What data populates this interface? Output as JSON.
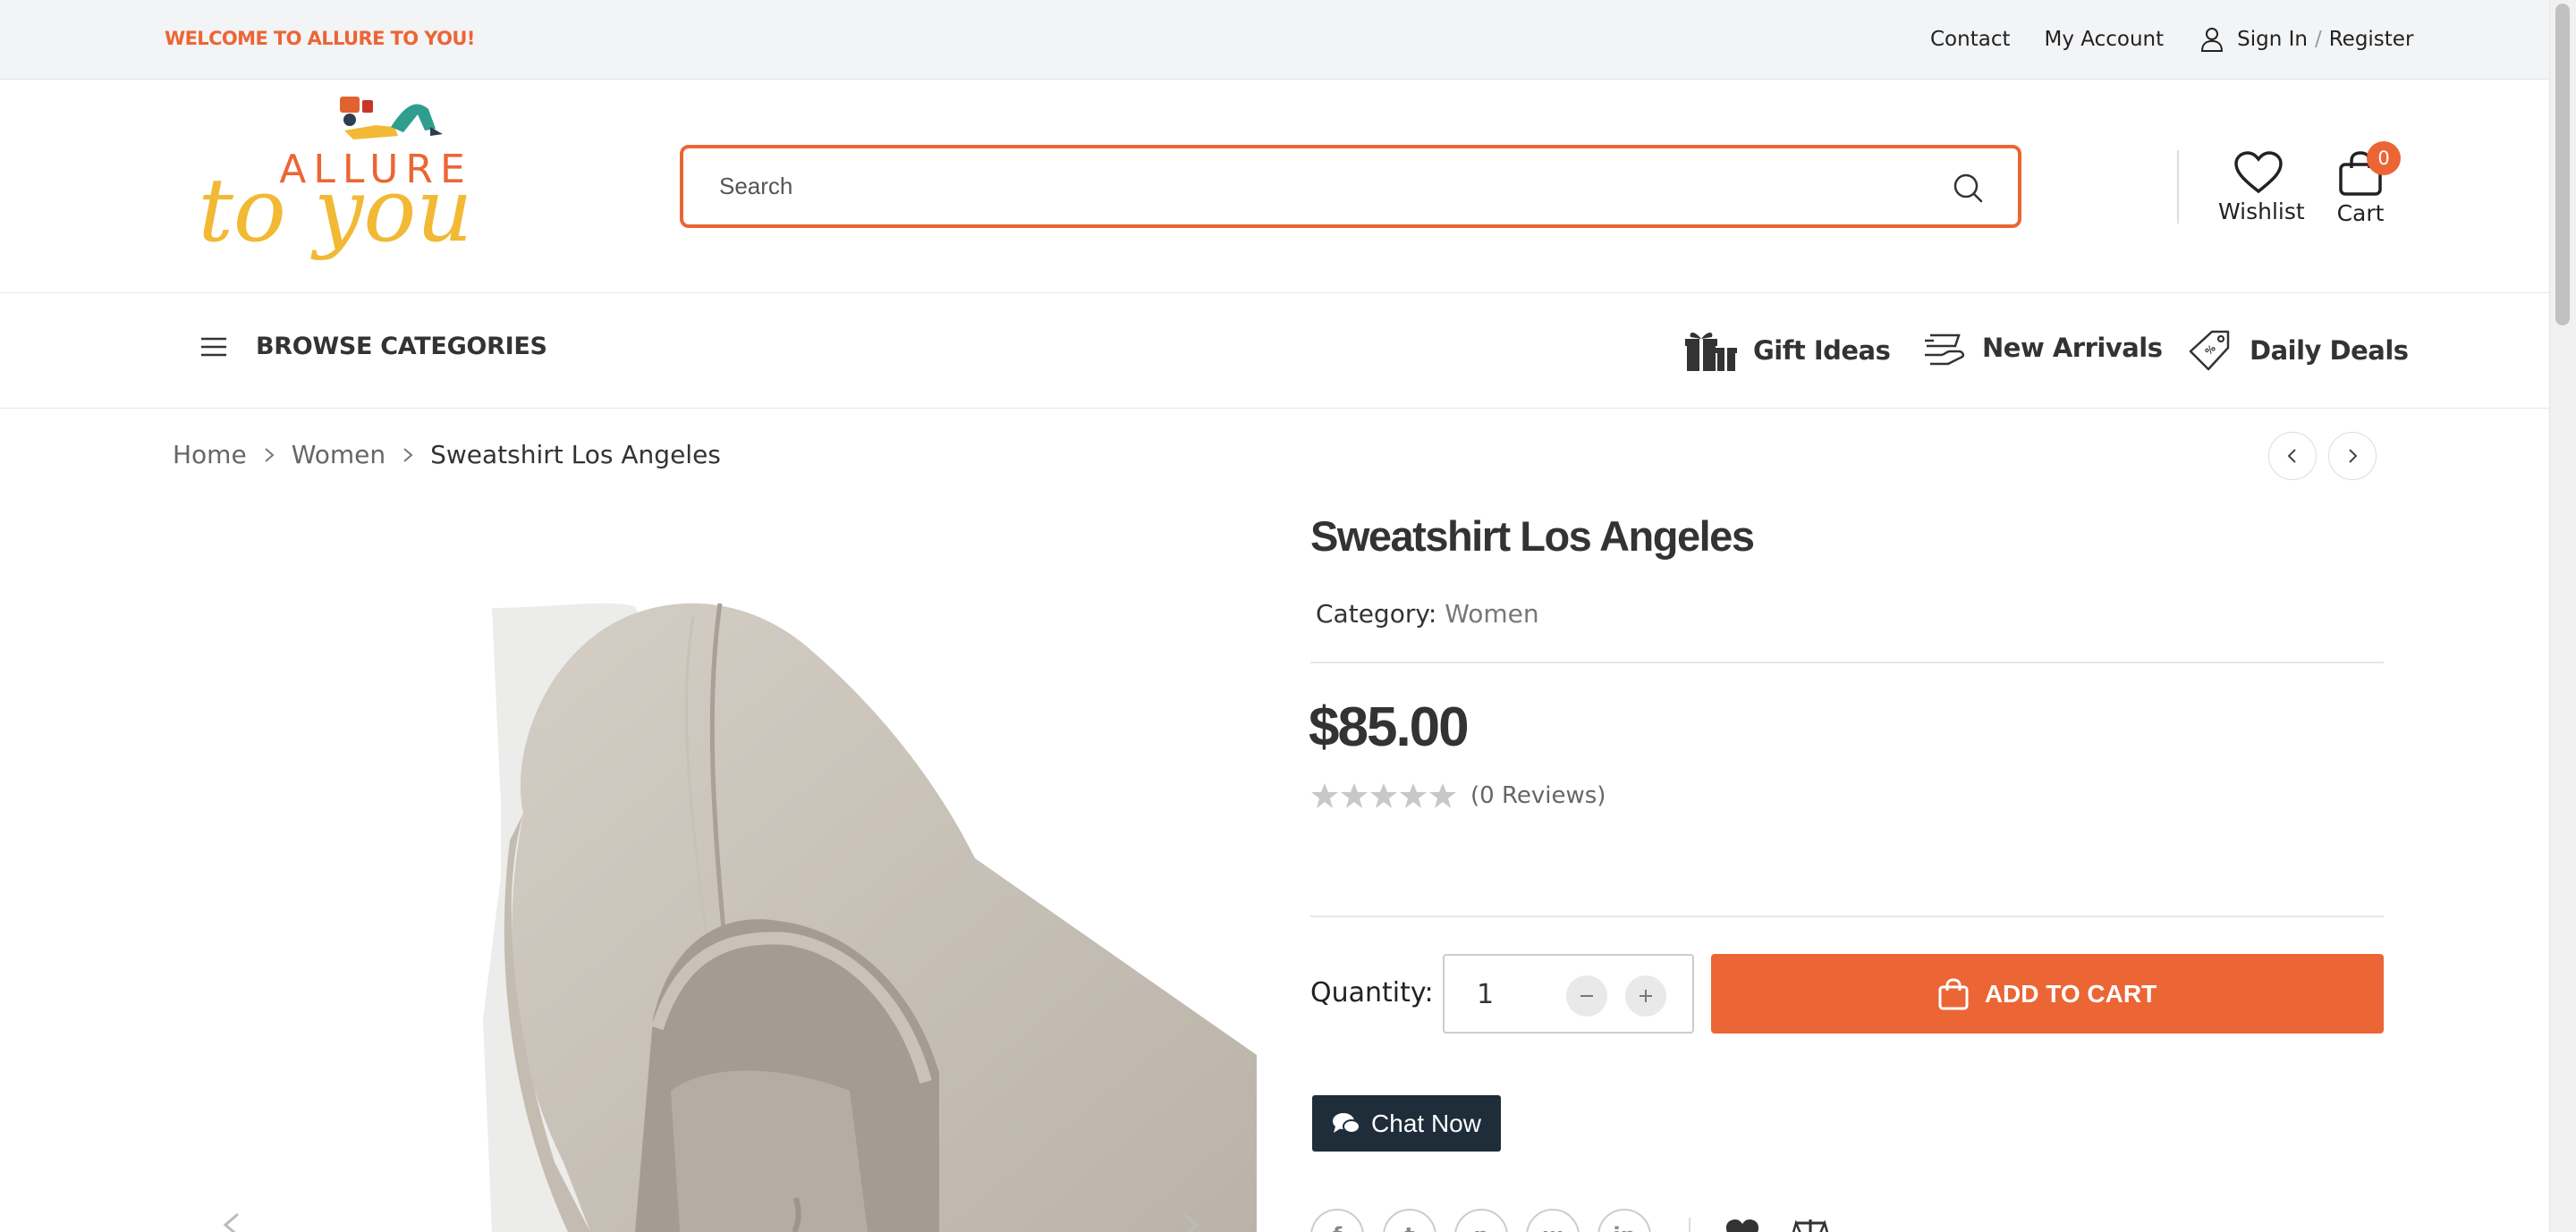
{
  "topbar": {
    "welcome": "WELCOME TO ALLURE TO YOU!",
    "links": {
      "contact": "Contact",
      "account": "My Account",
      "sign_in": "Sign In",
      "separator": "/",
      "register": "Register"
    }
  },
  "header": {
    "logo": {
      "top_text": "ALLURE",
      "script_text": "to you"
    },
    "search": {
      "placeholder": "Search",
      "value": ""
    },
    "wishlist_label": "Wishlist",
    "cart_label": "Cart",
    "cart_count": "0"
  },
  "nav": {
    "browse_label": "BROWSE CATEGORIES",
    "items": [
      {
        "label": "Gift Ideas",
        "icon": "gift-icon"
      },
      {
        "label": "New Arrivals",
        "icon": "delivery-icon"
      },
      {
        "label": "Daily Deals",
        "icon": "tag-icon"
      }
    ]
  },
  "breadcrumb": [
    "Home",
    "Women",
    "Sweatshirt Los Angeles"
  ],
  "product": {
    "title": "Sweatshirt Los Angeles",
    "category_label": "Category:",
    "category_value": "Women",
    "price": "$85.00",
    "rating": 0,
    "rating_max": 5,
    "reviews": "(0 Reviews)",
    "quantity_label": "Quantity:",
    "quantity": "1",
    "add_to_cart": "ADD TO CART",
    "chat": "Chat Now",
    "social": [
      "facebook-icon",
      "twitter-icon",
      "pinterest-icon",
      "whatsapp-icon",
      "linkedin-icon"
    ]
  },
  "colors": {
    "accent": "#ec6535",
    "dark": "#1f2d3a",
    "logo_yellow": "#f2b934"
  }
}
